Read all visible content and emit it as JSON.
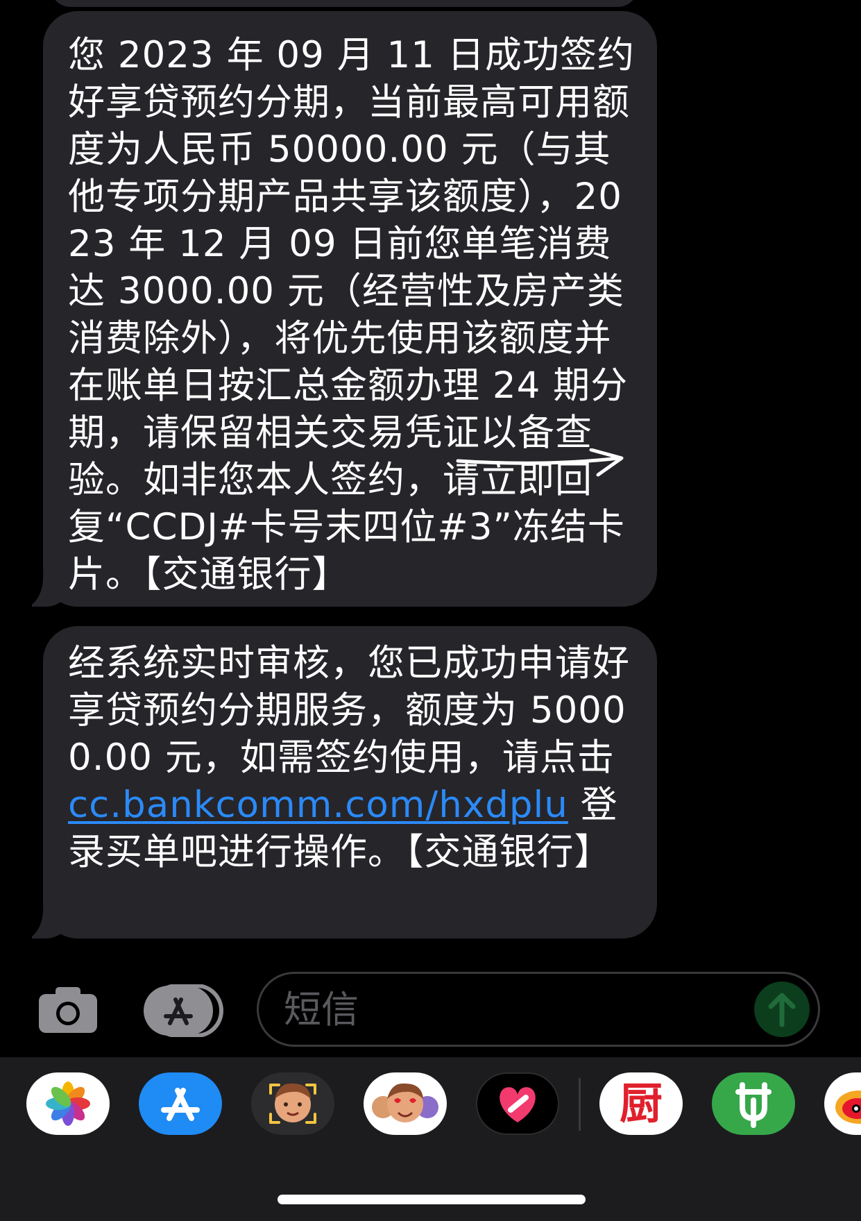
{
  "messages": [
    {
      "text": "您 2023 年 09 月 11 日成功签约好享贷预约分期，当前最高可用额度为人民币 50000.00 元（与其他专项分期产品共享该额度），2023 年 12 月 09 日前您单笔消费达 3000.00 元（经营性及房产类消费除外），将优先使用该额度并在账单日按汇总金额办理 24 期分期，请保留相关交易凭证以备查验。如非您本人签约，请立即回复“CCDJ#卡号末四位#3”冻结卡片。【交通银行】"
    },
    {
      "text_before_link": "经系统实时审核，您已成功申请好享贷预约分期服务，额度为 50000.00 元，如需签约使用，请点击 ",
      "link": "cc.bankcomm.com/hxdplu",
      "text_after_link": " 登录买单吧进行操作。【交通银行】"
    }
  ],
  "input_bar": {
    "placeholder": "短信"
  },
  "app_drawer": {
    "apps": [
      "photos",
      "app-store",
      "memoji",
      "memoji-stickers",
      "digital-touch",
      "chu-app",
      "green-app",
      "weibo"
    ],
    "chu_label": "厨"
  },
  "colors": {
    "background": "#000000",
    "bubble": "#26252a",
    "link": "#2b8af7",
    "send_button": "#0c3d1c",
    "drawer": "#1c1c1e"
  }
}
